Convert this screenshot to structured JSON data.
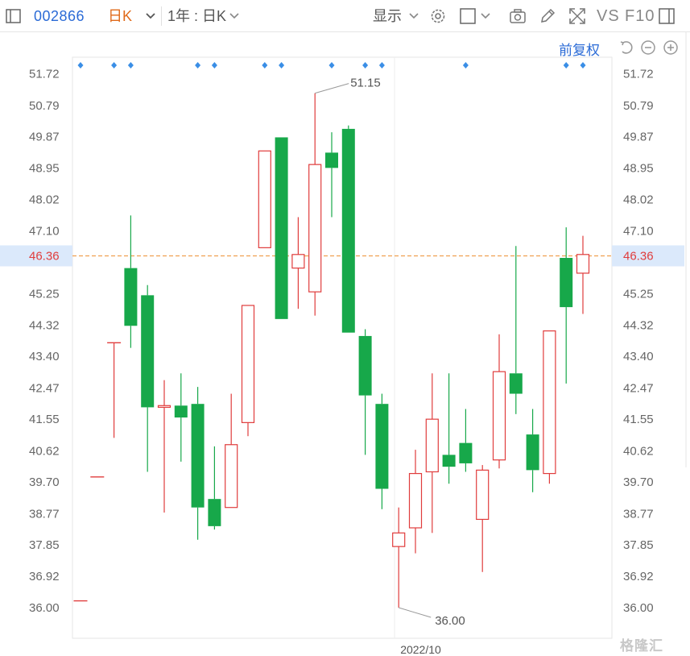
{
  "toolbar": {
    "stock_code": "002866",
    "kline_type": "日K",
    "period": "1年 : 日K",
    "display": "显示",
    "vs_label": "VS",
    "f10_label": "F10"
  },
  "subbar": {
    "adjust_label": "前复权"
  },
  "icons": {
    "panel_toggle": "panel-icon",
    "dropdown": "chevron-down-icon",
    "settings": "gear-icon",
    "checkbox": "checkbox-icon",
    "camera": "camera-icon",
    "draw": "pencil-icon",
    "fullscreen": "fullscreen-icon",
    "sidebar": "sidebar-icon",
    "undo": "undo-icon",
    "zoom_out": "zoom-out-icon",
    "zoom_in": "zoom-in-icon"
  },
  "colors": {
    "up": "#e03c3c",
    "down": "#17a84a",
    "current_line": "#f0a050",
    "marker": "#3a8ee6",
    "code": "#2b6bd6",
    "kline_type": "#e06a1a"
  },
  "watermark": "格隆汇",
  "chart_data": {
    "type": "candlestick",
    "y_ticks": [
      51.72,
      50.79,
      49.87,
      48.95,
      48.02,
      47.1,
      46.36,
      45.25,
      44.32,
      43.4,
      42.47,
      41.55,
      40.62,
      39.7,
      38.77,
      37.85,
      36.92,
      36.0
    ],
    "y_tick_labels": [
      "51.72",
      "50.79",
      "49.87",
      "48.95",
      "48.02",
      "47.10",
      "46.36",
      "45.25",
      "44.32",
      "43.40",
      "42.47",
      "41.55",
      "40.62",
      "39.70",
      "38.77",
      "37.85",
      "36.92",
      "36.00"
    ],
    "ylim": [
      35.2,
      52.1
    ],
    "current_price": 46.36,
    "current_price_label": "46.36",
    "max_label": "51.15",
    "max_value": 51.15,
    "max_index": 14,
    "min_label": "36.00",
    "min_value": 36.0,
    "min_index": 19,
    "x_date_label": "2022/10",
    "x_date_index": 19,
    "marker_indices": [
      0,
      2,
      3,
      7,
      8,
      11,
      12,
      15,
      17,
      18,
      23,
      29,
      30
    ],
    "candles": [
      {
        "o": 36.2,
        "h": 36.2,
        "l": 36.2,
        "c": 36.2,
        "dir": "up"
      },
      {
        "o": 39.85,
        "h": 39.85,
        "l": 39.85,
        "c": 39.85,
        "dir": "up"
      },
      {
        "o": 43.8,
        "h": 43.8,
        "l": 41.0,
        "c": 43.8,
        "dir": "up"
      },
      {
        "o": 46.0,
        "h": 47.55,
        "l": 43.65,
        "c": 44.3,
        "dir": "down"
      },
      {
        "o": 45.2,
        "h": 45.5,
        "l": 40.0,
        "c": 41.9,
        "dir": "down"
      },
      {
        "o": 41.9,
        "h": 42.7,
        "l": 38.8,
        "c": 41.95,
        "dir": "up"
      },
      {
        "o": 41.95,
        "h": 42.9,
        "l": 40.3,
        "c": 41.6,
        "dir": "down"
      },
      {
        "o": 42.0,
        "h": 42.5,
        "l": 38.0,
        "c": 38.95,
        "dir": "down"
      },
      {
        "o": 39.2,
        "h": 40.75,
        "l": 38.3,
        "c": 38.4,
        "dir": "down"
      },
      {
        "o": 38.95,
        "h": 42.3,
        "l": 38.95,
        "c": 40.8,
        "dir": "up"
      },
      {
        "o": 41.45,
        "h": 44.9,
        "l": 41.05,
        "c": 44.9,
        "dir": "up"
      },
      {
        "o": 46.6,
        "h": 49.45,
        "l": 46.6,
        "c": 49.45,
        "dir": "up"
      },
      {
        "o": 49.85,
        "h": 49.85,
        "l": 44.5,
        "c": 44.5,
        "dir": "down"
      },
      {
        "o": 46.0,
        "h": 47.5,
        "l": 44.8,
        "c": 46.4,
        "dir": "up"
      },
      {
        "o": 45.3,
        "h": 51.15,
        "l": 44.6,
        "c": 49.05,
        "dir": "up"
      },
      {
        "o": 49.4,
        "h": 50.0,
        "l": 47.5,
        "c": 48.95,
        "dir": "down"
      },
      {
        "o": 50.1,
        "h": 50.2,
        "l": 44.1,
        "c": 44.1,
        "dir": "down"
      },
      {
        "o": 44.0,
        "h": 44.2,
        "l": 40.5,
        "c": 42.25,
        "dir": "down"
      },
      {
        "o": 42.0,
        "h": 42.3,
        "l": 38.9,
        "c": 39.5,
        "dir": "down"
      },
      {
        "o": 37.8,
        "h": 38.95,
        "l": 36.0,
        "c": 38.2,
        "dir": "up"
      },
      {
        "o": 38.35,
        "h": 40.65,
        "l": 37.6,
        "c": 39.95,
        "dir": "up"
      },
      {
        "o": 40.0,
        "h": 42.9,
        "l": 38.2,
        "c": 41.55,
        "dir": "up"
      },
      {
        "o": 40.5,
        "h": 42.9,
        "l": 39.65,
        "c": 40.15,
        "dir": "down"
      },
      {
        "o": 40.85,
        "h": 41.85,
        "l": 40.0,
        "c": 40.25,
        "dir": "down"
      },
      {
        "o": 38.6,
        "h": 40.2,
        "l": 37.05,
        "c": 40.05,
        "dir": "up"
      },
      {
        "o": 40.35,
        "h": 44.05,
        "l": 40.1,
        "c": 42.95,
        "dir": "up"
      },
      {
        "o": 42.9,
        "h": 46.65,
        "l": 41.7,
        "c": 42.3,
        "dir": "down"
      },
      {
        "o": 41.1,
        "h": 41.85,
        "l": 39.4,
        "c": 40.05,
        "dir": "down"
      },
      {
        "o": 39.95,
        "h": 44.15,
        "l": 39.65,
        "c": 44.15,
        "dir": "up"
      },
      {
        "o": 46.3,
        "h": 47.2,
        "l": 42.6,
        "c": 44.85,
        "dir": "down"
      },
      {
        "o": 45.85,
        "h": 46.95,
        "l": 44.65,
        "c": 46.4,
        "dir": "up"
      }
    ]
  }
}
